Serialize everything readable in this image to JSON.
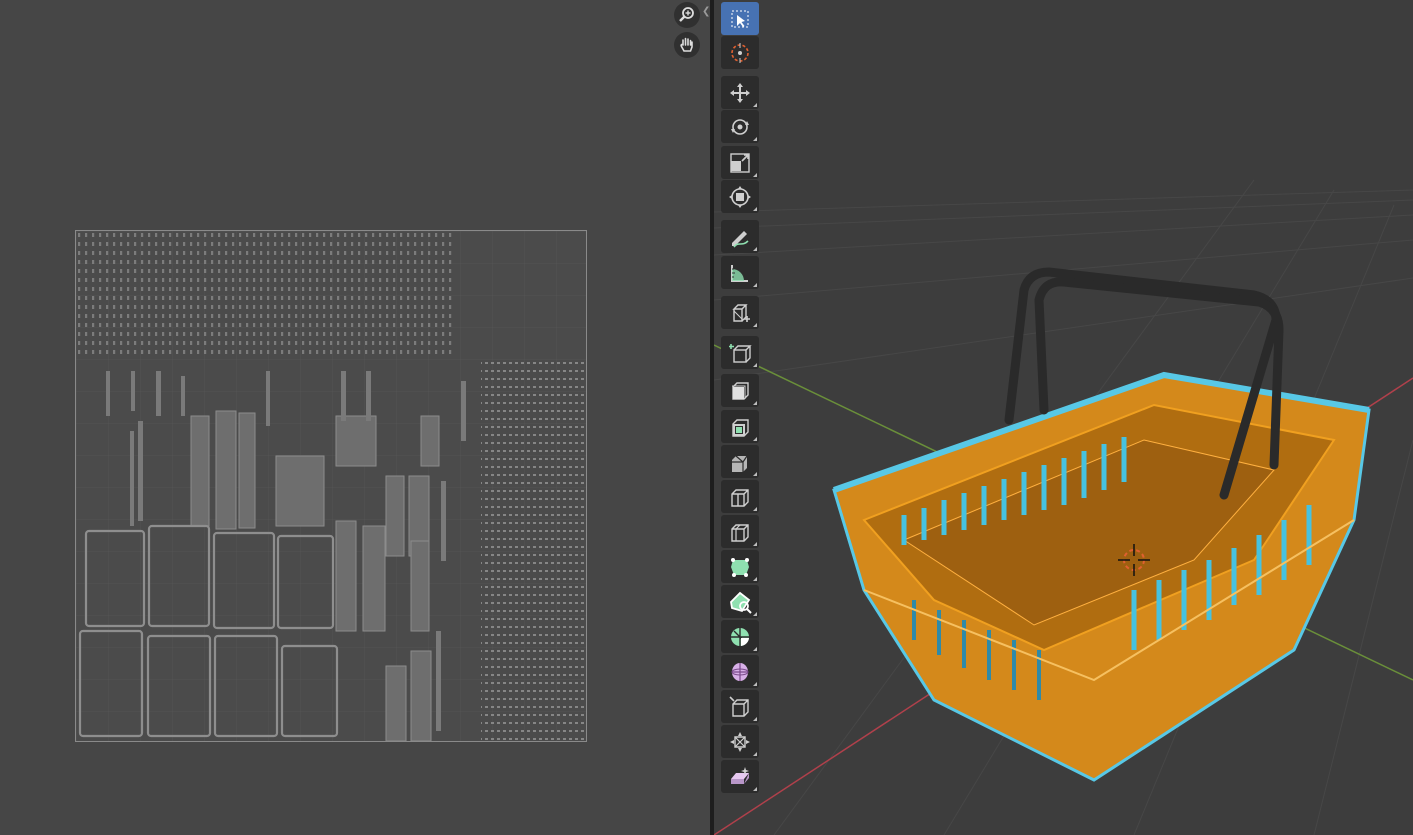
{
  "uv_editor": {
    "nav": [
      {
        "name": "zoom",
        "icon": "zoom-in-icon"
      },
      {
        "name": "pan",
        "icon": "hand-pan-icon"
      }
    ],
    "collapse_icon": "chevron-left-icon"
  },
  "viewport": {
    "toolbar": [
      {
        "name": "select-box",
        "icon": "select-box-icon",
        "active": true
      },
      {
        "name": "cursor",
        "icon": "3d-cursor-icon"
      },
      {
        "name": "move",
        "icon": "move-icon"
      },
      {
        "name": "rotate",
        "icon": "rotate-icon"
      },
      {
        "name": "scale",
        "icon": "scale-icon"
      },
      {
        "name": "transform",
        "icon": "transform-icon"
      },
      {
        "name": "annotate",
        "icon": "annotate-icon"
      },
      {
        "name": "measure",
        "icon": "measure-icon"
      },
      {
        "name": "add-cube",
        "icon": "add-cube-icon"
      },
      {
        "name": "extrude-region",
        "icon": "extrude-region-icon"
      },
      {
        "name": "inset-faces",
        "icon": "inset-faces-icon"
      },
      {
        "name": "bevel",
        "icon": "bevel-icon"
      },
      {
        "name": "loop-cut",
        "icon": "loop-cut-icon"
      },
      {
        "name": "knife",
        "icon": "knife-icon"
      },
      {
        "name": "poly-build",
        "icon": "poly-build-icon"
      },
      {
        "name": "spin",
        "icon": "spin-icon"
      },
      {
        "name": "smooth",
        "icon": "smooth-icon"
      },
      {
        "name": "edge-slide",
        "icon": "edge-slide-icon"
      },
      {
        "name": "shrink-fatten",
        "icon": "shrink-fatten-icon"
      },
      {
        "name": "shear",
        "icon": "shear-icon"
      },
      {
        "name": "rip-region",
        "icon": "rip-region-icon"
      },
      {
        "name": "extrude-manifold",
        "icon": "extrude-manifold-icon"
      }
    ],
    "colors": {
      "x_axis": "#b0404b",
      "y_axis": "#6a8f3a",
      "selection": "#f0a020",
      "selection_edge": "#58c8e6",
      "handle": "#2a2a2a"
    }
  }
}
